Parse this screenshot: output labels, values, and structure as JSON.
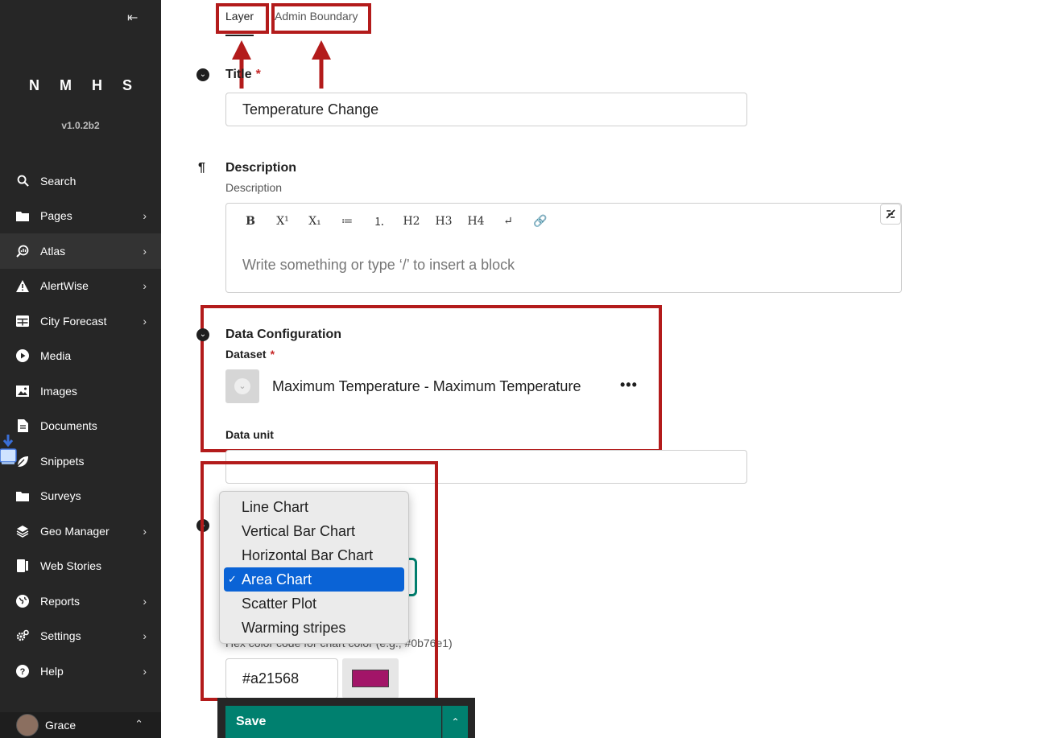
{
  "sidebar": {
    "brand": "N M H S",
    "version": "v1.0.2b2",
    "collapse_icon": "collapse-left-icon",
    "items": [
      {
        "label": "Search",
        "icon": "search-icon",
        "has_submenu": false
      },
      {
        "label": "Pages",
        "icon": "folder-icon",
        "has_submenu": true
      },
      {
        "label": "Atlas",
        "icon": "atlas-icon",
        "has_submenu": true
      },
      {
        "label": "AlertWise",
        "icon": "warning-icon",
        "has_submenu": true
      },
      {
        "label": "City Forecast",
        "icon": "table-icon",
        "has_submenu": true
      },
      {
        "label": "Media",
        "icon": "play-icon",
        "has_submenu": false
      },
      {
        "label": "Images",
        "icon": "image-icon",
        "has_submenu": false
      },
      {
        "label": "Documents",
        "icon": "document-icon",
        "has_submenu": false
      },
      {
        "label": "Snippets",
        "icon": "snippet-icon",
        "has_submenu": false
      },
      {
        "label": "Surveys",
        "icon": "folder-icon",
        "has_submenu": false
      },
      {
        "label": "Geo Manager",
        "icon": "layers-icon",
        "has_submenu": true
      },
      {
        "label": "Web Stories",
        "icon": "book-icon",
        "has_submenu": false
      },
      {
        "label": "Reports",
        "icon": "globe-icon",
        "has_submenu": true
      },
      {
        "label": "Settings",
        "icon": "cogs-icon",
        "has_submenu": true
      },
      {
        "label": "Help",
        "icon": "help-icon",
        "has_submenu": true
      }
    ],
    "user": {
      "name": "Grace"
    }
  },
  "tabs": [
    {
      "label": "Layer",
      "active": true
    },
    {
      "label": "Admin Boundary",
      "active": false
    }
  ],
  "form": {
    "title_label": "Title",
    "title_required": "*",
    "title_value": "Temperature Change",
    "description_label": "Description",
    "description_help": "Description",
    "editor_placeholder": "Write something or type ‘/’ to insert a block",
    "toolbar": [
      "B",
      "X¹",
      "X₁",
      "≔",
      "⒈",
      "H2",
      "H3",
      "H4",
      "↵",
      "🔗"
    ],
    "data_config_label": "Data Configuration",
    "dataset_label": "Dataset",
    "dataset_required": "*",
    "dataset_value": "Maximum Temperature - Maximum Temperature",
    "more_label": "•••",
    "data_unit_label": "Data unit",
    "data_unit_value": "",
    "chart_type_options": [
      "Line Chart",
      "Vertical Bar Chart",
      "Horizontal Bar Chart",
      "Area Chart",
      "Scatter Plot",
      "Warming stripes"
    ],
    "chart_type_selected": "Area Chart",
    "color_help": "Hex color code for chart color (e.g., #0b76e1)",
    "color_value": "#a21568"
  },
  "footer": {
    "save_label": "Save",
    "more_icon": "chevron-up-icon"
  },
  "colors": {
    "sidebar_bg": "#262626",
    "accent": "#00806f",
    "annotation_red": "#b31b1b",
    "selection_blue": "#0a63d6",
    "chart_color": "#a21568"
  }
}
